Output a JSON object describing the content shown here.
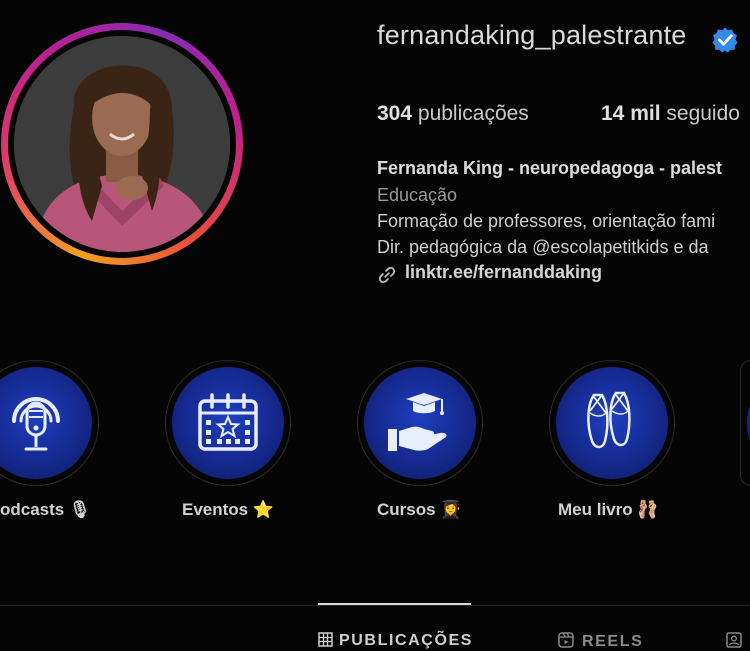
{
  "profile": {
    "username": "fernandaking_palestrante",
    "stats": {
      "posts_count": "304",
      "posts_label": "publicações",
      "followers_count": "14 mil",
      "followers_label": "seguido"
    },
    "bio": {
      "name": "Fernanda King - neuropedagoga - palest",
      "category": "Educação",
      "line1": "Formação de professores, orientação fami",
      "line2": "Dir. pedagógica da @escolapetitkids e da",
      "link": "linktr.ee/fernanddaking"
    }
  },
  "highlights": [
    {
      "label": "odcasts 🎙",
      "icon": "podcast-microphone-icon"
    },
    {
      "label": "Eventos ⭐",
      "icon": "calendar-star-icon"
    },
    {
      "label": "Cursos 👩‍🎓",
      "icon": "hand-graduation-cap-icon"
    },
    {
      "label": "Meu livro 🩰",
      "icon": "ballet-shoes-icon"
    }
  ],
  "tabs": {
    "posts": "PUBLICAÇÕES",
    "reels": "REELS"
  },
  "colors": {
    "background": "#050505",
    "highlight_blue": "#1a35a8",
    "verified_blue": "#2f8ae8"
  }
}
